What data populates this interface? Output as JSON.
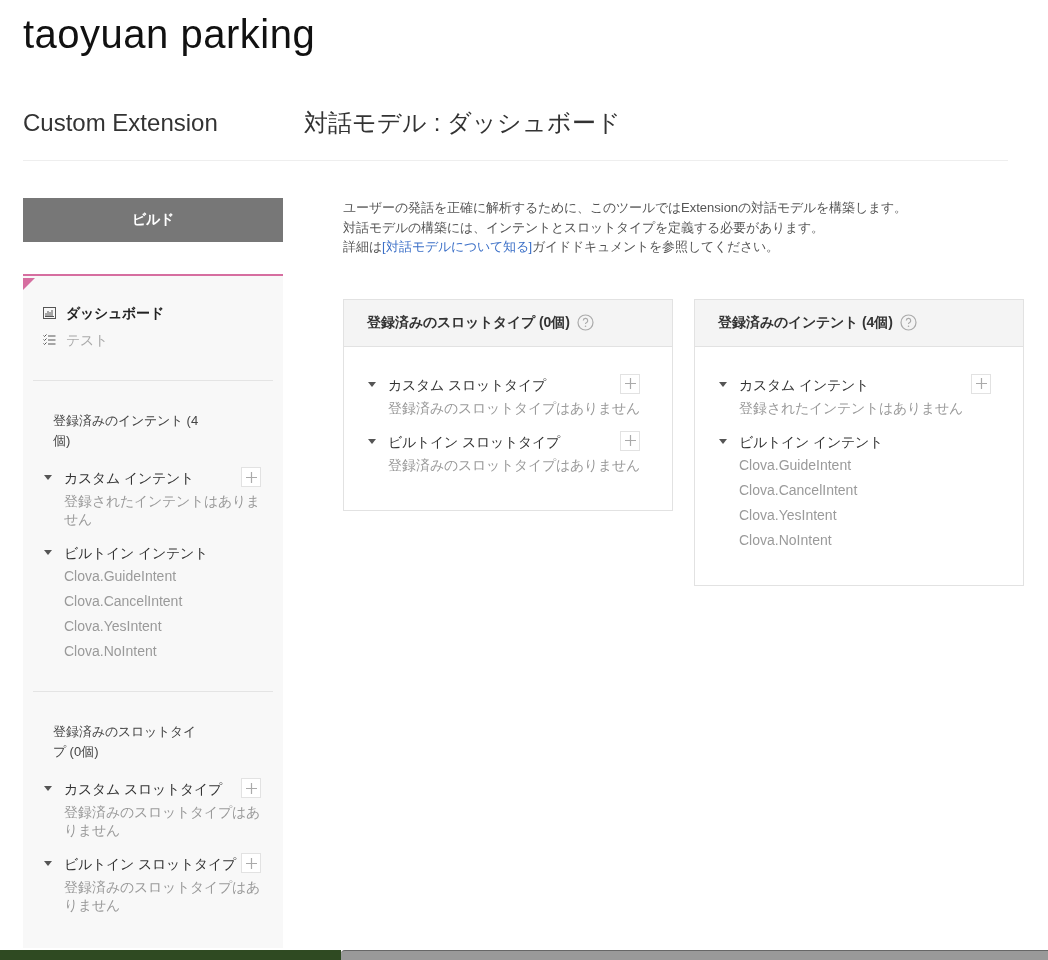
{
  "app_title": "taoyuan parking",
  "header": {
    "section": "Custom Extension",
    "page_title": "対話モデル : ダッシュボード"
  },
  "sidebar": {
    "build_button": "ビルド",
    "nav": [
      {
        "label": "ダッシュボード",
        "kind": "chart",
        "selected": true
      },
      {
        "label": "テスト",
        "kind": "checklist",
        "selected": false
      }
    ],
    "sections": [
      {
        "title": "登録済みのインテント (4個)",
        "groups": [
          {
            "label": "カスタム インテント",
            "expanded": true,
            "addable": true,
            "empty_text": "登録されたインテントはありません"
          },
          {
            "label": "ビルトイン インテント",
            "expanded": true,
            "addable": false,
            "items": [
              "Clova.GuideIntent",
              "Clova.CancelIntent",
              "Clova.YesIntent",
              "Clova.NoIntent"
            ]
          }
        ]
      },
      {
        "title": "登録済みのスロットタイプ (0個)",
        "groups": [
          {
            "label": "カスタム スロットタイプ",
            "expanded": true,
            "addable": true,
            "empty_text": "登録済みのスロットタイプはありません"
          },
          {
            "label": "ビルトイン スロットタイプ",
            "expanded": true,
            "addable": true,
            "empty_text": "登録済みのスロットタイプはありません"
          }
        ]
      }
    ]
  },
  "description": {
    "lines": [
      "ユーザーの発話を正確に解析するために、このツールではExtensionの対話モデルを構築します。",
      "対話モデルの構築には、インテントとスロットタイプを定義する必要があります。"
    ],
    "link_line": {
      "before": "詳細は",
      "link": "[対話モデルについて知る]",
      "after": "ガイドドキュメントを参照してください。"
    }
  },
  "cards": [
    {
      "title": "登録済みのスロットタイプ (0個)",
      "groups": [
        {
          "label": "カスタム スロットタイプ",
          "expanded": true,
          "addable": true,
          "empty_text": "登録済みのスロットタイプはありません"
        },
        {
          "label": "ビルトイン スロットタイプ",
          "expanded": true,
          "addable": true,
          "empty_text": "登録済みのスロットタイプはありません"
        }
      ]
    },
    {
      "title": "登録済みのインテント (4個)",
      "groups": [
        {
          "label": "カスタム インテント",
          "expanded": true,
          "addable": true,
          "empty_text": "登録されたインテントはありません"
        },
        {
          "label": "ビルトイン インテント",
          "expanded": true,
          "addable": false,
          "items": [
            "Clova.GuideIntent",
            "Clova.CancelIntent",
            "Clova.YesIntent",
            "Clova.NoIntent"
          ]
        }
      ]
    }
  ]
}
